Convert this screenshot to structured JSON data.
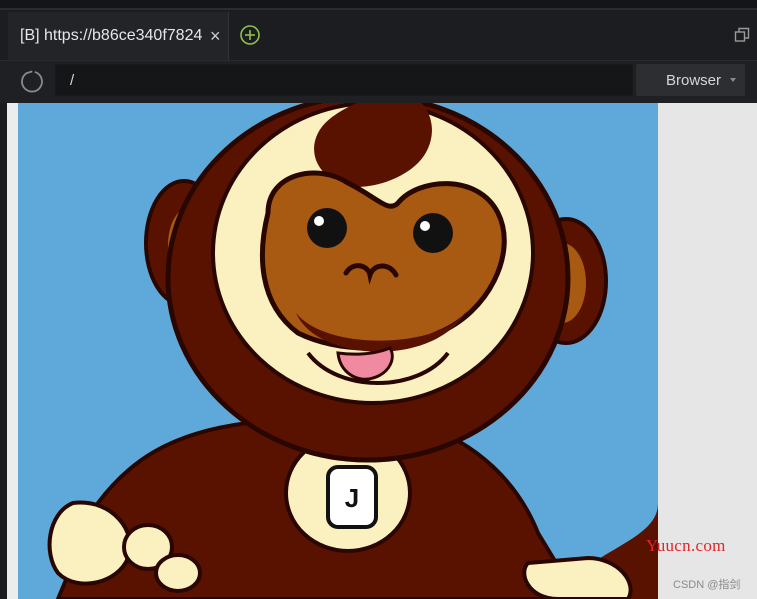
{
  "tabs": [
    {
      "label": "[B] https://b86ce340f7824",
      "close": "×",
      "active": true
    }
  ],
  "toolbar": {
    "address_value": "/",
    "browser_select": "Browser"
  },
  "content": {
    "image_subject": "cartoon-monkey",
    "badge_glyph": "J"
  },
  "watermark": {
    "brand": "Yuucn.com",
    "credit": "CSDN @指剑"
  },
  "colors": {
    "accent_green": "#8fc24a",
    "brand_red": "#e0252b",
    "sky_blue": "#5ea9d9",
    "monkey_brown": "#5a1200",
    "face_tan": "#a85a12",
    "cream": "#fbf0c0",
    "tongue_pink": "#f08aa0"
  }
}
